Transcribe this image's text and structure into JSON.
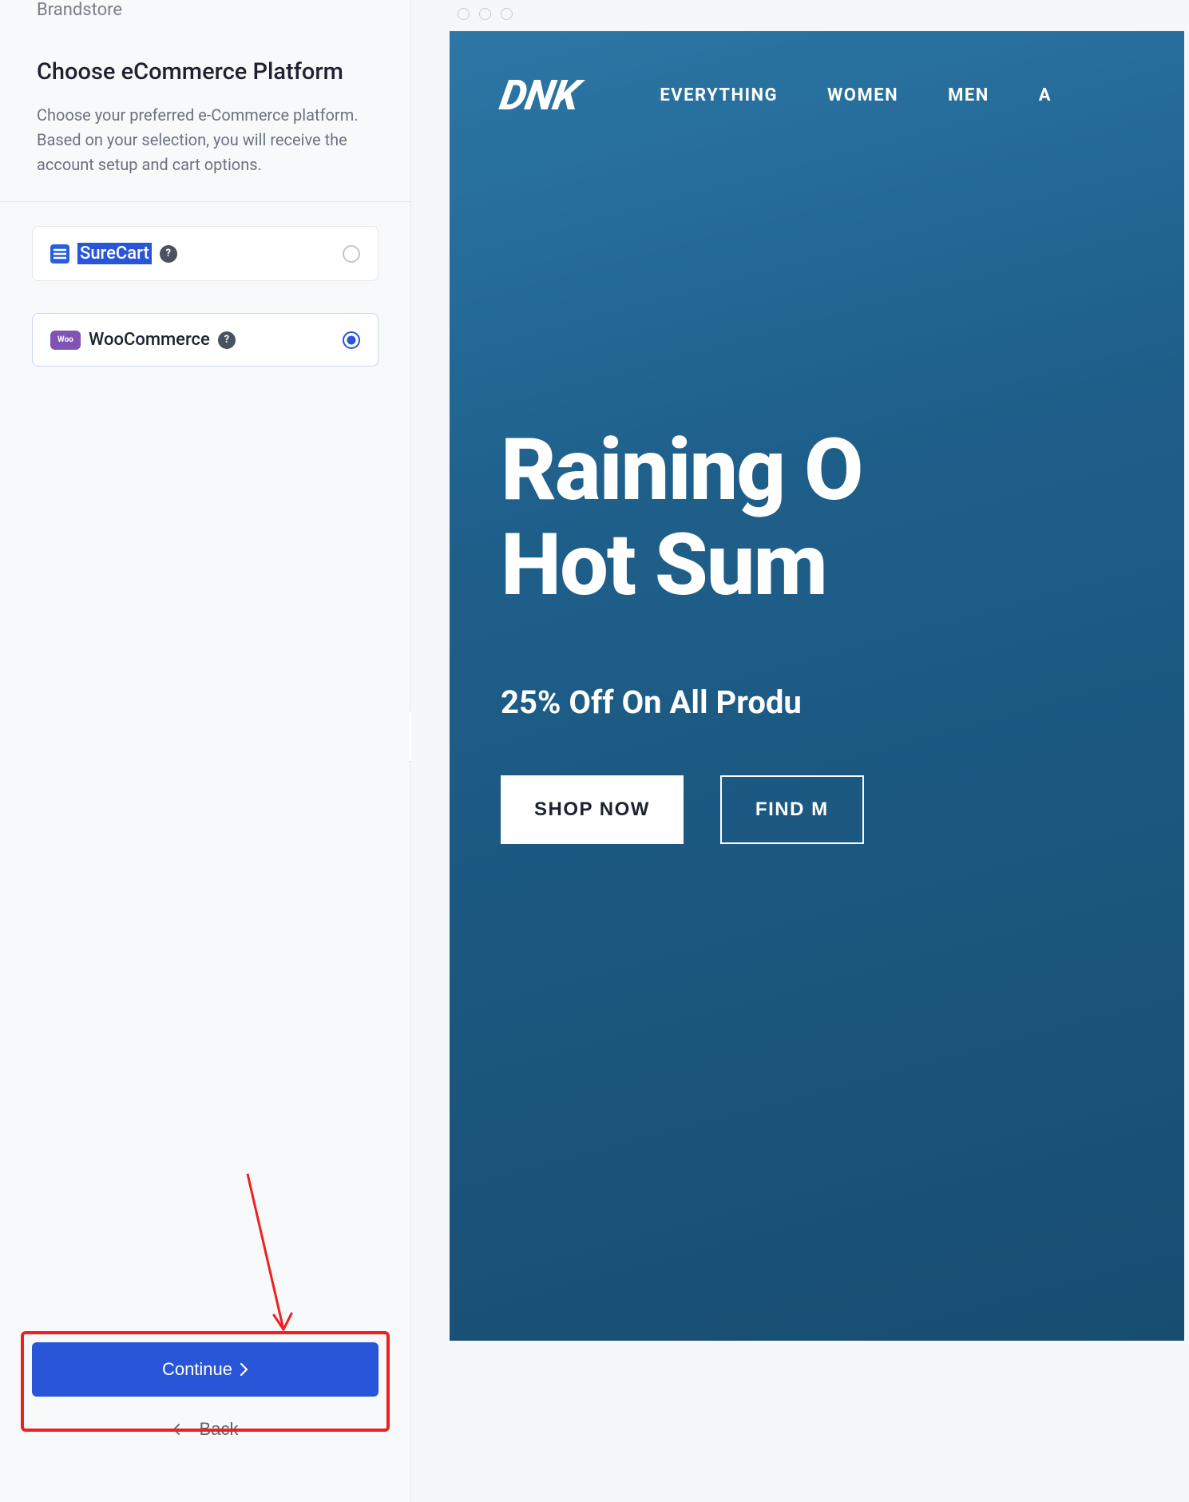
{
  "sidebar": {
    "brand": "Brandstore",
    "title": "Choose eCommerce Platform",
    "description": "Choose your preferred e-Commerce platform. Based on your selection, you will receive the account setup and cart options.",
    "options": [
      {
        "name": "SureCart",
        "logo_text": "≡",
        "selected": false,
        "highlighted": true
      },
      {
        "name": "WooCommerce",
        "logo_text": "Woo",
        "selected": true,
        "highlighted": false
      }
    ],
    "continue_label": "Continue",
    "back_label": "Back"
  },
  "preview": {
    "logo": "DNK",
    "nav": [
      "EVERYTHING",
      "WOMEN",
      "MEN",
      "A"
    ],
    "hero_line1": "Raining O",
    "hero_line2": "Hot Sum",
    "hero_sub": "25% Off On All Produ",
    "btn_primary": "SHOP NOW",
    "btn_outline": "FIND M"
  }
}
